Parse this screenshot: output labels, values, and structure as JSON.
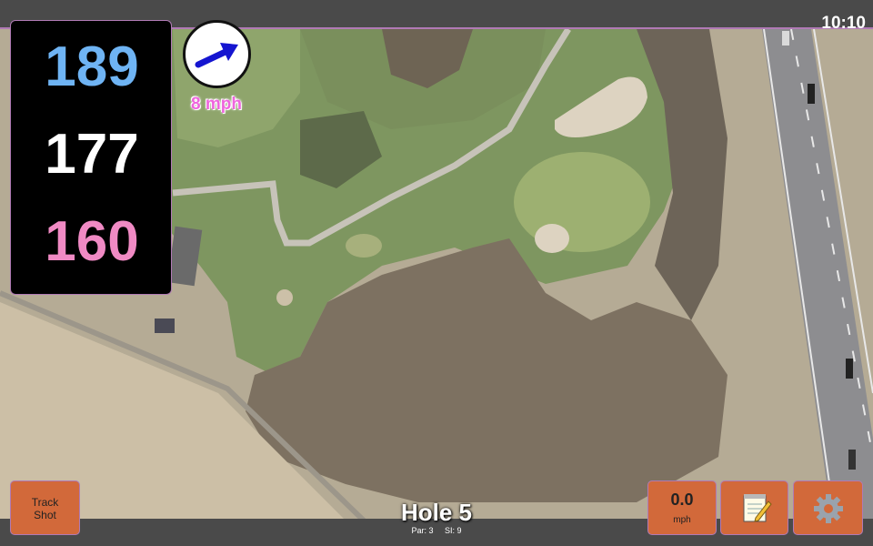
{
  "status_bar": {
    "time": "10:10"
  },
  "distances": {
    "back": "189",
    "middle": "177",
    "front": "160"
  },
  "wind": {
    "speed_label": "8 mph",
    "arrow_icon": "arrow-right-icon"
  },
  "buttons": {
    "track_shot_line1": "Track",
    "track_shot_line2": "Shot",
    "speed_value": "0.0",
    "speed_unit": "mph",
    "notes_icon": "notepad-icon",
    "settings_icon": "gear-icon"
  },
  "hole": {
    "title": "Hole 5",
    "par": "Par: 3",
    "si": "SI: 9"
  },
  "colors": {
    "back_distance": "#6fb4f4",
    "middle_distance": "#ffffff",
    "front_distance": "#f08ac4",
    "button": "#d2693a",
    "wind_label": "#ee66dd",
    "bar": "#4a4a4a"
  }
}
